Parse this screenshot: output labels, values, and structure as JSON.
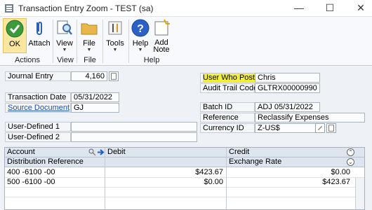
{
  "window": {
    "title": "Transaction Entry Zoom  -  TEST (sa)",
    "minimize": "—",
    "maximize": "☐",
    "close": "✕"
  },
  "ribbon": {
    "ok": "OK",
    "attach": "Attach",
    "view": "View",
    "file": "File",
    "tools": "Tools",
    "help": "Help",
    "add_note_1": "Add",
    "add_note_2": "Note",
    "groups": {
      "actions": "Actions",
      "view": "View",
      "file": "File",
      "help": "Help"
    }
  },
  "form": {
    "journal_entry_label": "Journal Entry",
    "journal_entry_value": "4,160",
    "transaction_date_label": "Transaction Date",
    "transaction_date_value": "05/31/2022",
    "source_document_label": "Source Document",
    "source_document_value": "GJ",
    "user_defined_1_label": "User-Defined 1",
    "user_defined_1_value": "",
    "user_defined_2_label": "User-Defined 2",
    "user_defined_2_value": "",
    "user_who_posted_label": "User Who Posted",
    "user_who_posted_value": "Chris",
    "audit_trail_label": "Audit Trail Code",
    "audit_trail_value": "GLTRX00000990",
    "batch_id_label": "Batch ID",
    "batch_id_value": "ADJ 05/31/2022",
    "reference_label": "Reference",
    "reference_value": "Reclassify Expenses",
    "currency_id_label": "Currency ID",
    "currency_id_value": "Z-US$"
  },
  "grid": {
    "col_account": "Account",
    "col_debit": "Debit",
    "col_credit": "Credit",
    "col_dist_ref": "Distribution Reference",
    "col_exchange_rate": "Exchange Rate",
    "rows": [
      {
        "account": "400 -6100 -00",
        "debit": "$423.67",
        "credit": "$0.00"
      },
      {
        "account": "500 -6100 -00",
        "debit": "$0.00",
        "credit": "$423.67"
      }
    ]
  },
  "colors": {
    "highlight": "#f4f03a",
    "ok_button": "#fbe7a1",
    "link": "#1a4fbf"
  }
}
